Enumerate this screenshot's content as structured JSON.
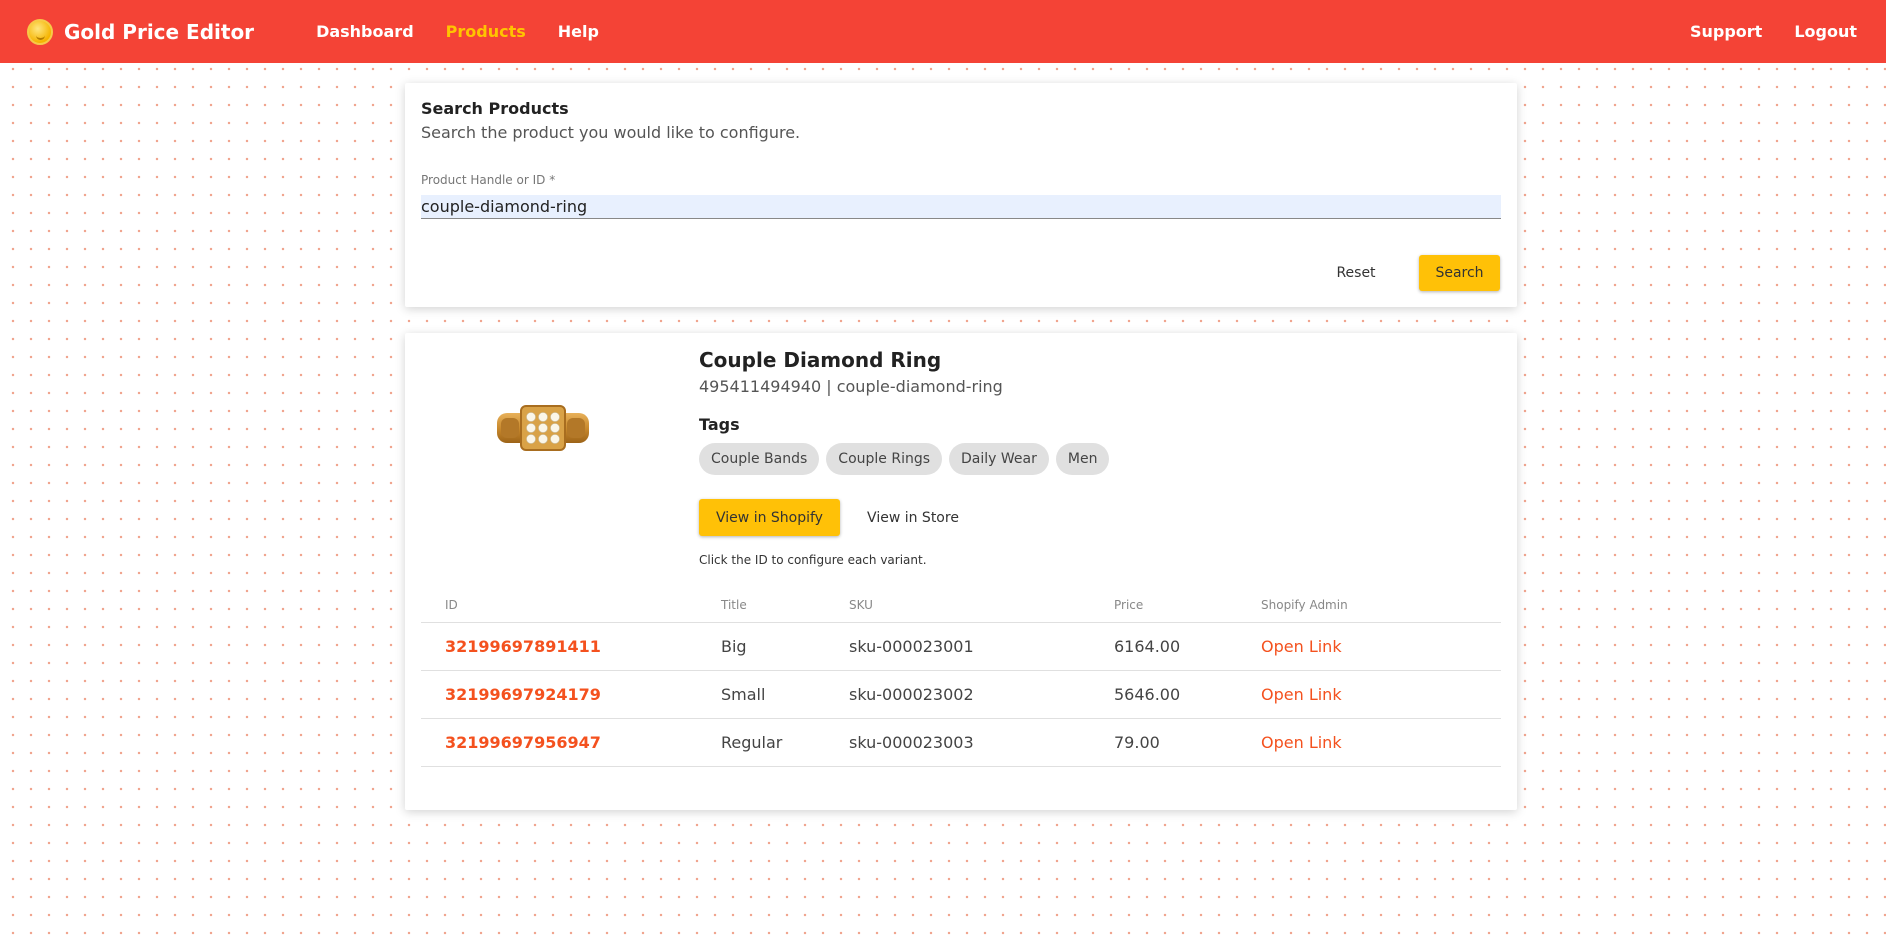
{
  "header": {
    "brand": "Gold Price Editor",
    "nav": [
      "Dashboard",
      "Products",
      "Help"
    ],
    "active_nav": "Products",
    "right_nav": [
      "Support",
      "Logout"
    ],
    "color": "#f44336",
    "active_color": "#ffc400"
  },
  "search": {
    "title": "Search Products",
    "subtitle": "Search the product you would like to configure.",
    "field_label": "Product Handle or ID *",
    "field_value": "couple-diamond-ring",
    "reset_label": "Reset",
    "search_label": "Search"
  },
  "product": {
    "title": "Couple Diamond Ring",
    "subtitle": "495411494940 | couple-diamond-ring",
    "tags_label": "Tags",
    "tags": [
      "Couple Bands",
      "Couple Rings",
      "Daily Wear",
      "Men"
    ],
    "view_shopify_label": "View in Shopify",
    "view_store_label": "View in Store",
    "hint": "Click the ID to configure each variant.",
    "image_icon": "gold-diamond-ring"
  },
  "variants": {
    "columns": [
      "ID",
      "Title",
      "SKU",
      "Price",
      "Shopify Admin"
    ],
    "rows": [
      {
        "id": "32199697891411",
        "title": "Big",
        "sku": "sku-000023001",
        "price": "6164.00",
        "link": "Open Link"
      },
      {
        "id": "32199697924179",
        "title": "Small",
        "sku": "sku-000023002",
        "price": "5646.00",
        "link": "Open Link"
      },
      {
        "id": "32199697956947",
        "title": "Regular",
        "sku": "sku-000023003",
        "price": "79.00",
        "link": "Open Link"
      }
    ]
  }
}
